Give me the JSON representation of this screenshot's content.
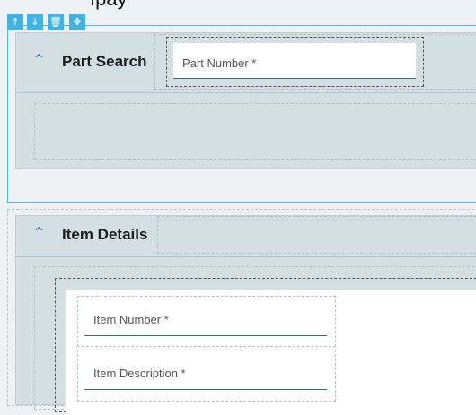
{
  "toolbar": {
    "move_up_icon": "↑",
    "move_down_icon": "↓",
    "delete_icon": "🗑",
    "drag_icon": "✥"
  },
  "page": {
    "title_fragment": "ıpay"
  },
  "part_search": {
    "title": "Part Search",
    "collapse_icon": "^",
    "part_number_label": "Part Number *"
  },
  "item_details": {
    "title": "Item Details",
    "collapse_icon": "^",
    "item_number_label": "Item Number *",
    "item_description_label": "Item Description *"
  },
  "colors": {
    "accent": "#3fb3e6",
    "panel": "#d3dfe3",
    "underline": "#2d6b90"
  }
}
